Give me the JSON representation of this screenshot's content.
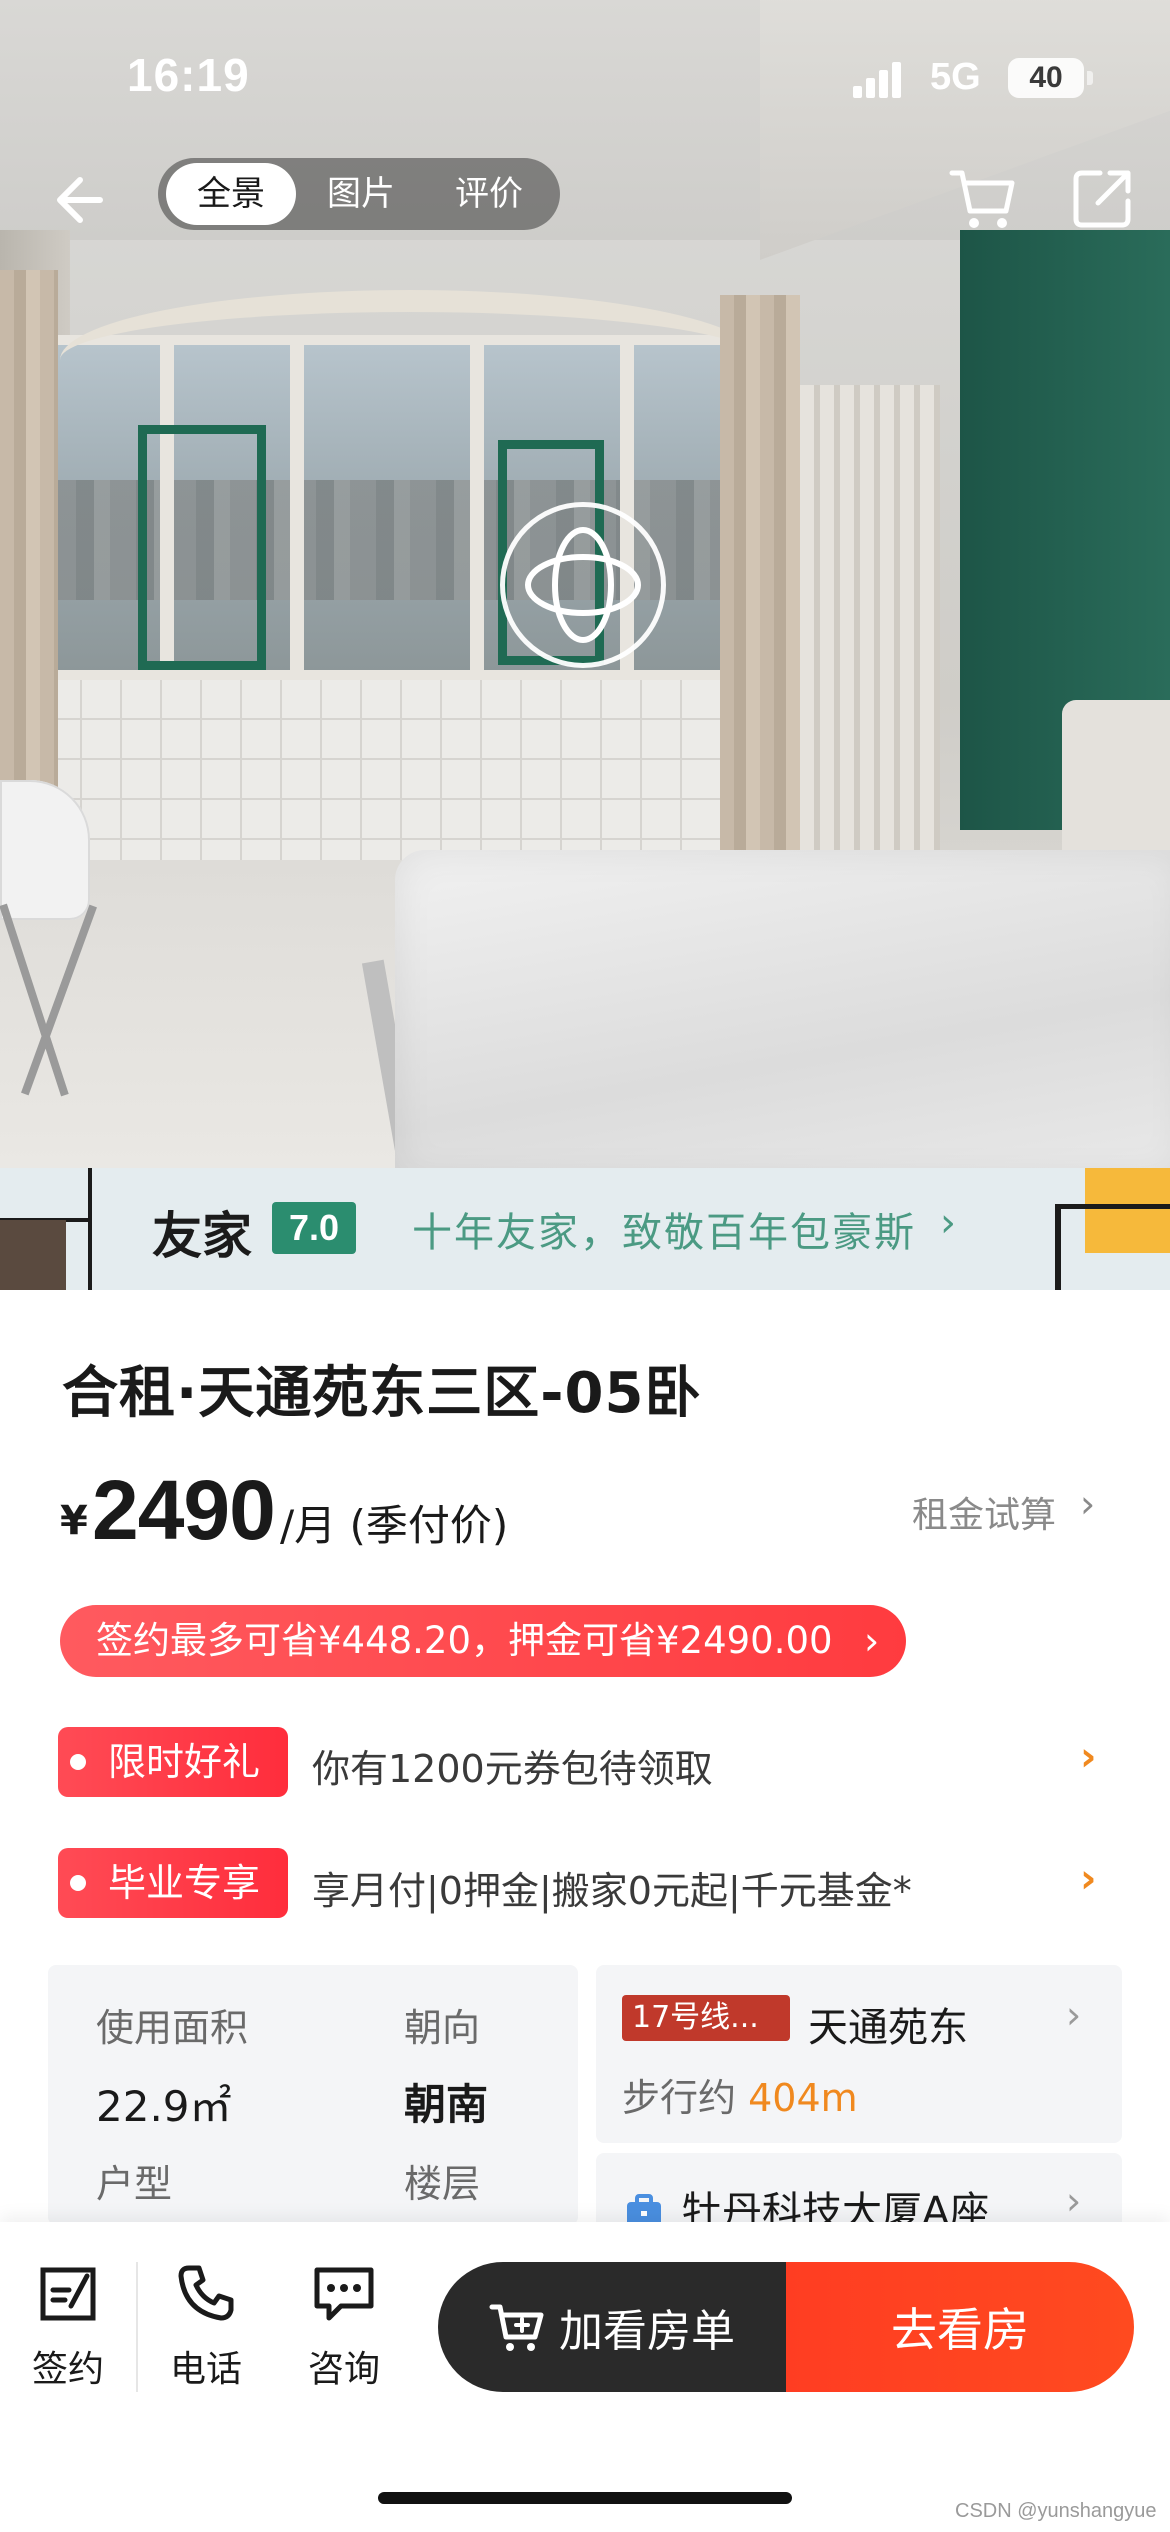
{
  "status_bar": {
    "time": "16:19",
    "network": "5G",
    "battery": "40"
  },
  "top_nav": {
    "tabs": [
      {
        "label": "全景",
        "active": true
      },
      {
        "label": "图片",
        "active": false
      },
      {
        "label": "评价",
        "active": false
      }
    ],
    "icons": {
      "back": "arrow-left-icon",
      "cart": "cart-icon",
      "share": "share-icon",
      "vr": "panorama-360-icon"
    }
  },
  "banner": {
    "brand": "友家",
    "score": "7.0",
    "slogan": "十年友家，致敬百年包豪斯",
    "chevron": "›",
    "accent": "#2b8d6f"
  },
  "listing": {
    "title": "合租·天通苑东三区-05卧",
    "currency": "¥",
    "price": "2490",
    "price_unit": "/月 (季付价)",
    "rent_calc_label": "租金试算",
    "savings_text": "签约最多可省¥448.20，押金可省¥2490.00",
    "promos": [
      {
        "tag": "限时好礼",
        "text": "你有1200元券包待领取"
      },
      {
        "tag": "毕业专享",
        "text": "享月付|0押金|搬家0元起|千元基金*"
      }
    ],
    "specs": {
      "area_label": "使用面积",
      "area_value": "22.9㎡",
      "orientation_label": "朝向",
      "orientation_value": "朝南",
      "layout_label": "户型",
      "floor_label": "楼层"
    },
    "location": {
      "line_badge": "17号线...",
      "station": "天通苑东",
      "walk_prefix": "步行约",
      "walk_distance": "404m",
      "building": "牡丹科技大厦A座"
    }
  },
  "bottom_bar": {
    "sign_label": "签约",
    "call_label": "电话",
    "consult_label": "咨询",
    "add_label": "加看房单",
    "go_label": "去看房"
  },
  "watermark": "CSDN @yunshangyue",
  "colors": {
    "price_red": "#ff3b3f",
    "accent_orange": "#f0891f",
    "cta_orange": "#ff4a1f",
    "dark": "#2a2a2a"
  }
}
